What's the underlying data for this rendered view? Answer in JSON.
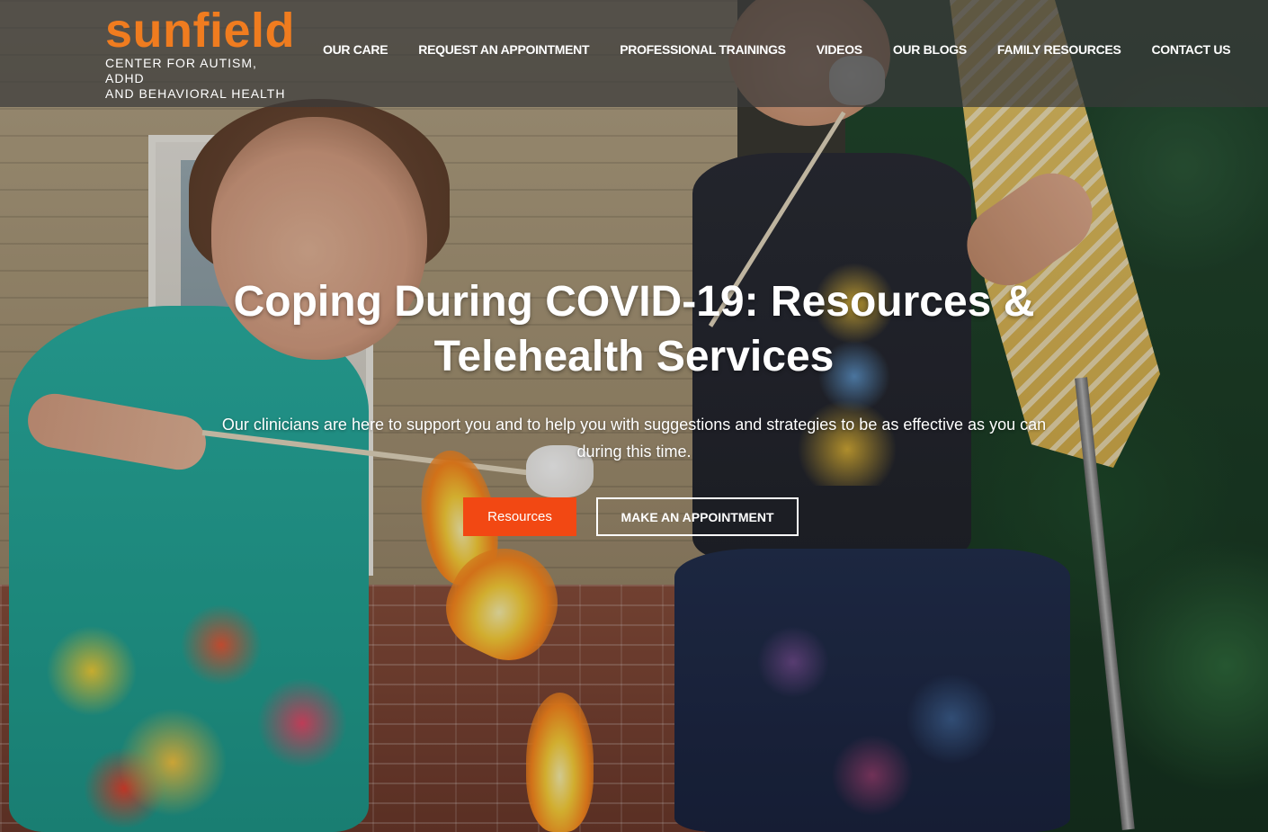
{
  "header": {
    "logo": {
      "word": "sunfield",
      "tagline_line1": "CENTER FOR AUTISM, ADHD",
      "tagline_line2": "AND BEHAVIORAL HEALTH",
      "color": "#f07c1f"
    },
    "nav": [
      {
        "label": "OUR CARE"
      },
      {
        "label": "REQUEST AN APPOINTMENT"
      },
      {
        "label": "PROFESSIONAL TRAININGS"
      },
      {
        "label": "VIDEOS"
      },
      {
        "label": "OUR BLOGS"
      },
      {
        "label": "FAMILY RESOURCES"
      },
      {
        "label": "CONTACT US"
      }
    ]
  },
  "hero": {
    "title": "Coping During COVID-19: Resources & Telehealth Services",
    "subtitle": "Our clinicians are here to support you and to help you with suggestions and strategies to be as effective as you can during this time.",
    "primary_button": {
      "label": "Resources",
      "color": "#f24813"
    },
    "secondary_button": {
      "label": "MAKE AN APPOINTMENT"
    }
  }
}
